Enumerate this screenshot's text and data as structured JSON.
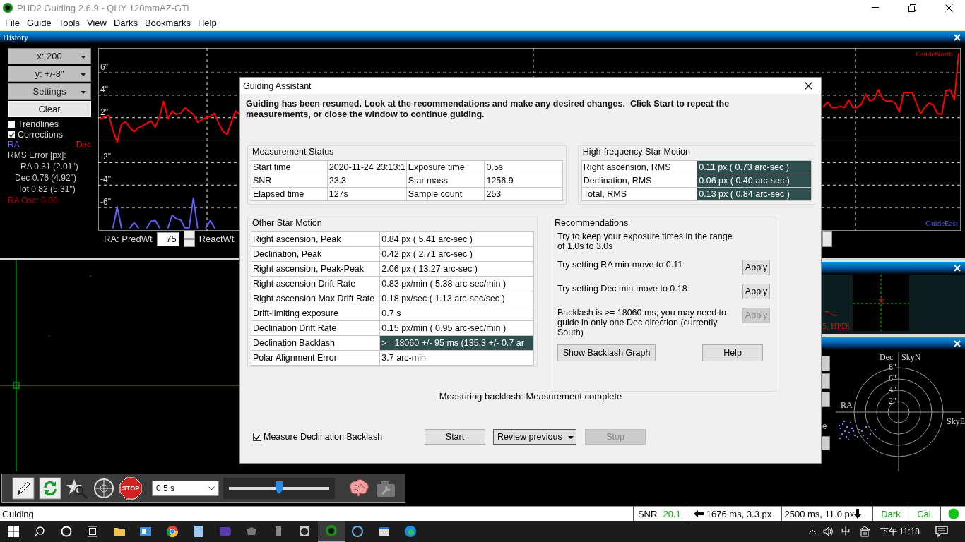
{
  "window": {
    "title": "PHD2 Guiding 2.6.9 - QHY 120mmAZ-GTi"
  },
  "menu": [
    "File",
    "Guide",
    "Tools",
    "View",
    "Darks",
    "Bookmarks",
    "Help"
  ],
  "history": {
    "title": "History",
    "dropdowns": [
      "x: 200",
      "y: +/-8\"",
      "Settings"
    ],
    "clear": "Clear",
    "options": [
      {
        "label": "Trendlines",
        "checked": false
      },
      {
        "label": "Corrections",
        "checked": true
      }
    ],
    "rms_title": "RMS Error [px]:",
    "rms": [
      "RA 0.31 (2.01\")",
      "Dec 0.76 (4.92\")",
      "Tot 0.82 (5.31\")"
    ],
    "osc": "RA Osc: 0.00",
    "chart_data": {
      "type": "line",
      "grid": true,
      "ylim": [
        -8,
        8.2
      ],
      "yticks": [
        {
          "value": 6,
          "label": "6\""
        },
        {
          "value": 4,
          "label": "4\""
        },
        {
          "value": 2,
          "label": "2\""
        },
        {
          "value": -2,
          "label": "-2\""
        },
        {
          "value": -4,
          "label": "-4\""
        },
        {
          "value": -6,
          "label": "-6\""
        }
      ],
      "series": [
        {
          "name": "RA",
          "color": "#6060ff",
          "values": [
            null,
            null,
            null,
            -7.8,
            -5.94,
            -7.8,
            null,
            -7.8,
            -7.33,
            -7.8,
            null,
            -7.8,
            -7.21,
            -7.15,
            -7.8,
            null,
            -7.8,
            -6.67,
            -7.0,
            -7.09,
            -7.8,
            -7.8,
            -5.15,
            -7.8,
            null,
            -7.8,
            -7.15,
            -7.8,
            null,
            null,
            null,
            null,
            null,
            null,
            null,
            null,
            null,
            null,
            null,
            null,
            null,
            null,
            null,
            null,
            null,
            null,
            null,
            null,
            null,
            null,
            null,
            null,
            null,
            null,
            null,
            null,
            null,
            null,
            null,
            null,
            null,
            null,
            null,
            null,
            null,
            null,
            null,
            null,
            null,
            null,
            null,
            null,
            null,
            null,
            null,
            null,
            null,
            null,
            null,
            null,
            null,
            null,
            null,
            null,
            null,
            null,
            null,
            null,
            null,
            null,
            null,
            null,
            null,
            null,
            null,
            null,
            null,
            null,
            null,
            null,
            null,
            null,
            null,
            null,
            null,
            null,
            null,
            null,
            null,
            null,
            null,
            null,
            null,
            null,
            null,
            null,
            null,
            null,
            null,
            null,
            null,
            null,
            null,
            null,
            null,
            null,
            null,
            null,
            null,
            null,
            null,
            null,
            null,
            null,
            null,
            null,
            null,
            null,
            null,
            null,
            null,
            null,
            null,
            null,
            null,
            null,
            null,
            null,
            null,
            null,
            null,
            null,
            null,
            null,
            null,
            null,
            null,
            null,
            null,
            null,
            null,
            null,
            null,
            null,
            null,
            null,
            null,
            null,
            null,
            null,
            null,
            null,
            null,
            null,
            null,
            null,
            null,
            null,
            null,
            null,
            null,
            null,
            null,
            null,
            null,
            null,
            null,
            null,
            null,
            null,
            null,
            null,
            null,
            null,
            null,
            null,
            null,
            null,
            null,
            null,
            null,
            null,
            null,
            null
          ]
        },
        {
          "name": "Dec",
          "color": "#ff0000",
          "values": [
            1.88,
            2.1,
            2.2,
            0.9,
            -0.18,
            1.4,
            1.64,
            1.1,
            0.75,
            1.1,
            1.27,
            1.5,
            1.7,
            1.15,
            2.06,
            3.45,
            1.9,
            2.6,
            2.3,
            2.4,
            2.85,
            2.6,
            2.3,
            1.6,
            1.8,
            2.0,
            2.1,
            2.4,
            1.5,
            0.8,
            0.5,
            1.6,
            2.6,
            2.3,
            null,
            null,
            null,
            null,
            null,
            null,
            null,
            null,
            null,
            null,
            null,
            null,
            null,
            null,
            null,
            null,
            null,
            null,
            null,
            null,
            null,
            null,
            null,
            null,
            null,
            null,
            null,
            null,
            null,
            null,
            null,
            null,
            null,
            null,
            null,
            null,
            null,
            null,
            null,
            null,
            null,
            null,
            null,
            null,
            null,
            null,
            null,
            null,
            null,
            null,
            null,
            null,
            null,
            null,
            null,
            null,
            null,
            null,
            null,
            null,
            null,
            null,
            null,
            null,
            null,
            null,
            null,
            null,
            null,
            null,
            null,
            null,
            null,
            null,
            null,
            null,
            null,
            null,
            null,
            null,
            null,
            null,
            null,
            null,
            null,
            null,
            null,
            null,
            null,
            null,
            null,
            null,
            null,
            null,
            null,
            null,
            null,
            null,
            null,
            null,
            null,
            null,
            null,
            null,
            null,
            null,
            null,
            null,
            null,
            null,
            null,
            null,
            null,
            null,
            null,
            null,
            null,
            null,
            null,
            null,
            null,
            null,
            null,
            null,
            null,
            null,
            null,
            null,
            null,
            null,
            null,
            null,
            null,
            null,
            null,
            null,
            null,
            2.95,
            3.4,
            2.9,
            2.9,
            3.0,
            2.9,
            3.6,
            2.91,
            2.91,
            3.2,
            4.1,
            3.5,
            3.64,
            4.48,
            3.7,
            3.45,
            3.52,
            3.3,
            2.5,
            4.24,
            4.24,
            4.24,
            3.3,
            2.36,
            2.9,
            3.3,
            3.1,
            2.36,
            2.3,
            4.4,
            4.48,
            3.6,
            7.7
          ]
        }
      ]
    },
    "north_label": "GuideNorth",
    "east_label": "GuideEast",
    "pred_label": "RA: PredWt",
    "pred_value": "75",
    "react_label": "ReactWt"
  },
  "star_profile": {
    "hfd_text": "5, HFD:"
  },
  "target": {
    "dec": "Dec",
    "sky_n": "SkyN",
    "ra": "RA",
    "sky_e": "SkyE",
    "rings": [
      "8\"",
      "6\"",
      "4\"",
      "2\""
    ],
    "cut_label": "e"
  },
  "toolbar": {
    "stop": "STOP",
    "exposure": "0.5 s",
    "level": 0.5
  },
  "status_bar": {
    "state": "Guiding",
    "snr_label": "SNR",
    "snr": "20.1",
    "ra_pulse": "1676 ms, 3.3 px",
    "dec_pulse": "2500 ms, 11.0 px",
    "dark": "Dark",
    "cal": "Cal"
  },
  "taskbar": {
    "ime": "中",
    "time": "下午 11:18"
  },
  "dialog": {
    "title": "Guiding Assistant",
    "intro": "Guiding has been resumed. Look at the recommendations and make any desired changes.  Click Start to repeat the measurements, or close the window to continue guiding.",
    "measurement_status": {
      "title": "Measurement Status",
      "rows": [
        [
          "Start time",
          "2020-11-24 23:13:1",
          "Exposure time",
          "0.5s"
        ],
        [
          "SNR",
          "23.3",
          "Star mass",
          "1256.9"
        ],
        [
          "Elapsed time",
          "127s",
          "Sample count",
          "253"
        ]
      ]
    },
    "high_frequency": {
      "title": "High-frequency Star Motion",
      "rows": [
        [
          "Right ascension, RMS",
          "0.11 px ( 0.73 arc-sec )"
        ],
        [
          "Declination, RMS",
          "0.06 px ( 0.40 arc-sec )"
        ],
        [
          "Total, RMS",
          "0.13 px ( 0.84 arc-sec )"
        ]
      ]
    },
    "other_motion": {
      "title": "Other Star Motion",
      "rows": [
        {
          "label": "Right ascension, Peak",
          "value": "0.84 px ( 5.41 arc-sec )",
          "highlighted": false
        },
        {
          "label": "Declination, Peak",
          "value": "0.42 px ( 2.71 arc-sec )",
          "highlighted": false
        },
        {
          "label": "Right ascension, Peak-Peak",
          "value": "2.06 px ( 13.27 arc-sec )",
          "highlighted": false
        },
        {
          "label": "Right ascension Drift Rate",
          "value": "0.83 px/min ( 5.38 arc-sec/min )",
          "highlighted": false
        },
        {
          "label": "Right ascension Max Drift Rate",
          "value": "0.18 px/sec ( 1.13 arc-sec/sec )",
          "highlighted": false
        },
        {
          "label": "Drift-limiting exposure",
          "value": "0.7 s",
          "highlighted": false
        },
        {
          "label": "Declination Drift Rate",
          "value": "0.15 px/min ( 0.95 arc-sec/min )",
          "highlighted": false
        },
        {
          "label": "Declination Backlash",
          "value": ">= 18060  +/-  95 ms (135.3  +/-  0.7 ar",
          "highlighted": true
        },
        {
          "label": "Polar Alignment Error",
          "value": "3.7 arc-min",
          "highlighted": false
        }
      ]
    },
    "recommendations": {
      "title": "Recommendations",
      "items": [
        {
          "text": "Try to keep your exposure times in the range of 1.0s to 3.0s"
        },
        {
          "text": "Try setting RA min-move to 0.11",
          "button": {
            "label": "Apply",
            "disabled": false
          }
        },
        {
          "text": "Try setting Dec min-move to 0.18",
          "button": {
            "label": "Apply",
            "disabled": false
          }
        },
        {
          "text": "Backlash is >= 18060 ms; you may need to guide in only one Dec direction (currently South)",
          "button": {
            "label": "Apply",
            "disabled": true
          }
        }
      ],
      "show_backlash": "Show Backlash Graph",
      "help": "Help"
    },
    "status": "Measuring backlash: Measurement complete",
    "measure_backlash": {
      "label": "Measure Declination Backlash",
      "checked": true
    },
    "buttons": [
      {
        "label": "Start",
        "kind": "plain",
        "disabled": false
      },
      {
        "label": "Review previous",
        "kind": "dropdown",
        "disabled": false
      },
      {
        "label": "Stop",
        "kind": "plain",
        "disabled": true
      }
    ]
  }
}
